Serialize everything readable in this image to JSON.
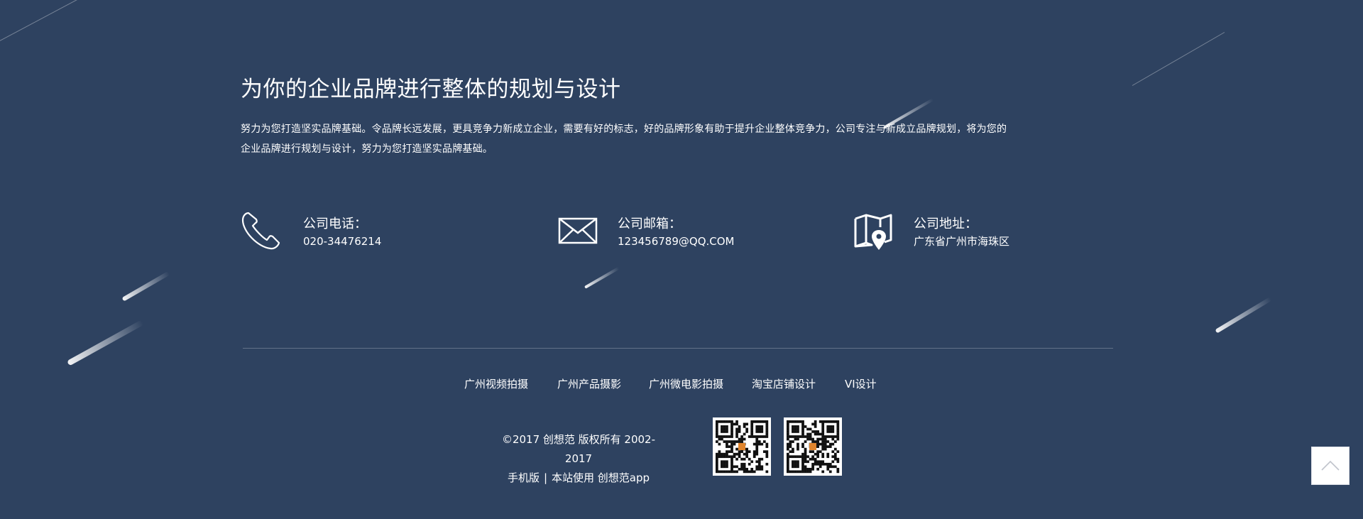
{
  "main": {
    "headline": "为你的企业品牌进行整体的规划与设计",
    "description": "努力为您打造坚实品牌基础。令品牌长远发展，更具竞争力新成立企业，需要有好的标志，好的品牌形象有助于提升企业整体竞争力，公司专注与新成立品牌规划，将为您的企业品牌进行规划与设计，努力为您打造坚实品牌基础。"
  },
  "contacts": [
    {
      "icon": "phone-icon",
      "label": "公司电话：",
      "value": "020-34476214"
    },
    {
      "icon": "mail-icon",
      "label": "公司邮箱：",
      "value": "123456789@QQ.COM"
    },
    {
      "icon": "map-pin-icon",
      "label": "公司地址：",
      "value": "广东省广州市海珠区"
    }
  ],
  "footer": {
    "links": [
      "广州视频拍摄",
      "广州产品摄影",
      "广州微电影拍摄",
      "淘宝店铺设计",
      "VI设计"
    ],
    "copyright": "©2017 创想范 版权所有 2002-2017",
    "mobile_label": "手机版",
    "separator": "|",
    "app_label": "本站使用 创想范app"
  },
  "qr_codes": [
    "qr-code",
    "qr-code"
  ],
  "back_to_top": {
    "icon": "chevron-up-icon"
  },
  "colors": {
    "background": "#2e4260",
    "text": "#ffffff",
    "button_bg": "#ffffff",
    "chevron": "#c0c4cc"
  }
}
